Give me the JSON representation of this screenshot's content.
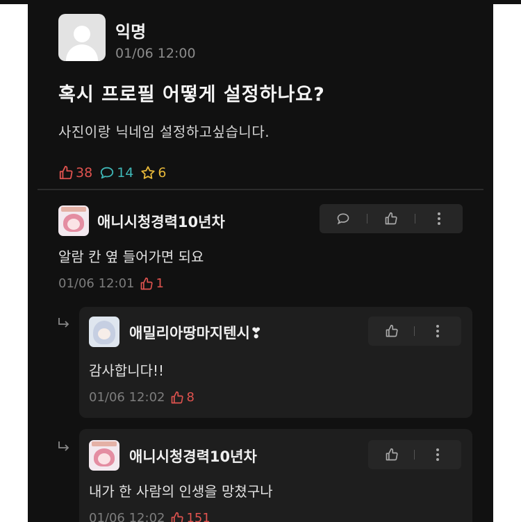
{
  "post": {
    "author": "익명",
    "time": "01/06 12:00",
    "title": "혹시 프로필 어떻게 설정하나요?",
    "body": "사진이랑 닉네임 설정하고싶습니다.",
    "likes": "38",
    "comments": "14",
    "scraps": "6"
  },
  "comments": [
    {
      "author": "애니시청경력10년차",
      "text": "알람 칸 옆 들어가면 되요",
      "time": "01/06 12:01",
      "likes": "1"
    }
  ],
  "replies": [
    {
      "author": "애밀리아땅마지텐시❣",
      "text": "감사합니다!!",
      "time": "01/06 12:02",
      "likes": "8"
    },
    {
      "author": "애니시청경력10년차",
      "text": "내가 한 사람의 인생을 망쳤구나",
      "time": "01/06 12:02",
      "likes": "151"
    }
  ],
  "colors": {
    "background": "#111111",
    "like": "#e0534f",
    "comment": "#3fb7b7",
    "scrap": "#e6b739"
  },
  "icons": [
    "thumbs-up-icon",
    "speech-bubble-icon",
    "star-icon",
    "more-vertical-icon",
    "reply-arrow-icon"
  ]
}
